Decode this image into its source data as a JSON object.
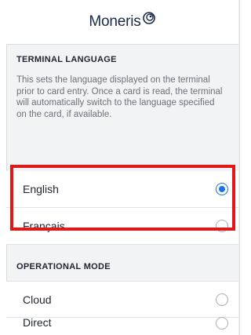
{
  "brand": {
    "name": "Moneris"
  },
  "terminal_language": {
    "title": "TERMINAL LANGUAGE",
    "description": "This sets the language displayed on the terminal prior to card entry. Once a card is read, the terminal will automatically switch to the language specified on the card, if available.",
    "options": [
      {
        "label": "English",
        "selected": true
      },
      {
        "label": "Français",
        "selected": false
      }
    ]
  },
  "operational_mode": {
    "title": "OPERATIONAL MODE",
    "options": [
      {
        "label": "Cloud",
        "selected": false
      },
      {
        "label": "Direct",
        "selected": false
      }
    ]
  },
  "colors": {
    "accent": "#1a73e8",
    "highlight": "#e01818",
    "brand_text": "#1b2a4a"
  }
}
